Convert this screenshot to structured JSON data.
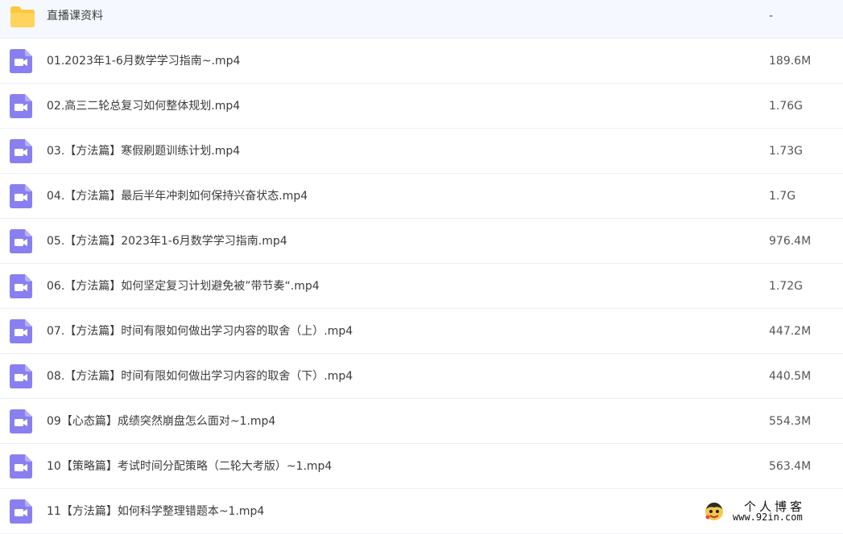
{
  "colors": {
    "folder": "#fbc83c",
    "video_icon": "#8a7ff0",
    "divider": "#eef0f4"
  },
  "files": [
    {
      "type": "folder",
      "icon": "folder-icon",
      "name": "直播课资料",
      "size": "-"
    },
    {
      "type": "video",
      "icon": "video-file-icon",
      "name": "01.2023年1-6月数学学习指南~.mp4",
      "size": "189.6M"
    },
    {
      "type": "video",
      "icon": "video-file-icon",
      "name": "02.高三二轮总复习如何整体规划.mp4",
      "size": "1.76G"
    },
    {
      "type": "video",
      "icon": "video-file-icon",
      "name": "03.【方法篇】寒假刷题训练计划.mp4",
      "size": "1.73G"
    },
    {
      "type": "video",
      "icon": "video-file-icon",
      "name": "04.【方法篇】最后半年冲刺如何保持兴奋状态.mp4",
      "size": "1.7G"
    },
    {
      "type": "video",
      "icon": "video-file-icon",
      "name": "05.【方法篇】2023年1-6月数学学习指南.mp4",
      "size": "976.4M"
    },
    {
      "type": "video",
      "icon": "video-file-icon",
      "name": "06.【方法篇】如何坚定复习计划避免被”带节奏“.mp4",
      "size": "1.72G"
    },
    {
      "type": "video",
      "icon": "video-file-icon",
      "name": "07.【方法篇】时间有限如何做出学习内容的取舍（上）.mp4",
      "size": "447.2M"
    },
    {
      "type": "video",
      "icon": "video-file-icon",
      "name": "08.【方法篇】时间有限如何做出学习内容的取舍（下）.mp4",
      "size": "440.5M"
    },
    {
      "type": "video",
      "icon": "video-file-icon",
      "name": "09【心态篇】成绩突然崩盘怎么面对~1.mp4",
      "size": "554.3M"
    },
    {
      "type": "video",
      "icon": "video-file-icon",
      "name": "10【策略篇】考试时间分配策略（二轮大考版）~1.mp4",
      "size": "563.4M"
    },
    {
      "type": "video",
      "icon": "video-file-icon",
      "name": "11【方法篇】如何科学整理错题本~1.mp4",
      "size": ""
    }
  ],
  "watermark": {
    "title": "个人博客",
    "url": "www.92in.com",
    "icon": "cartoon-avatar-icon"
  }
}
